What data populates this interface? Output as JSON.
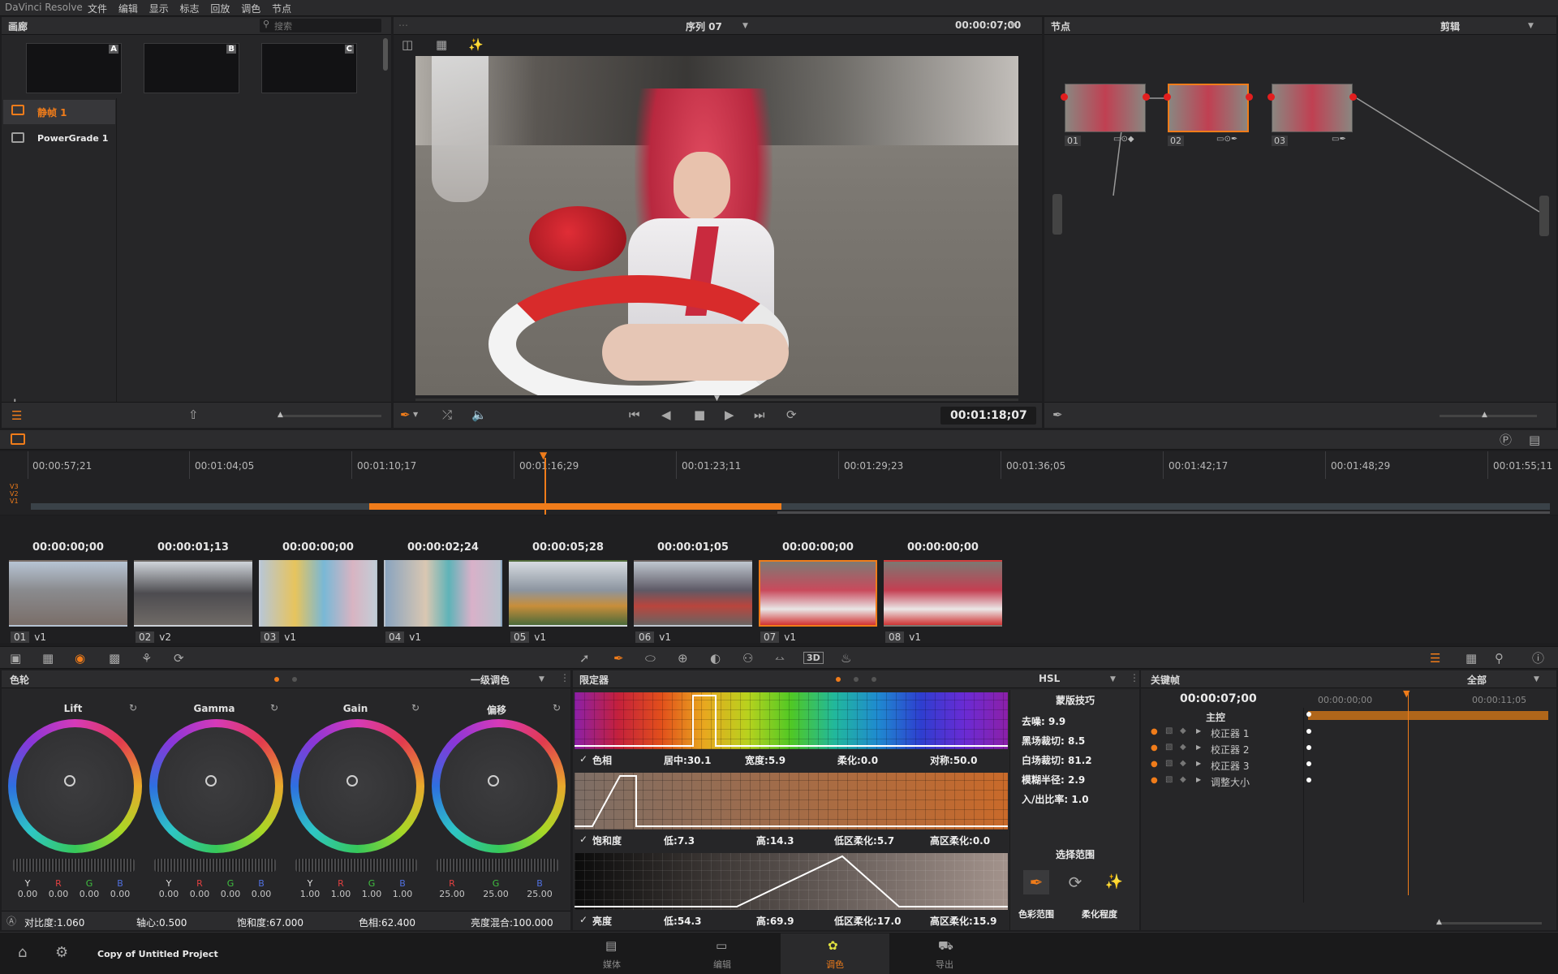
{
  "menubar": {
    "app": "DaVinci Resolve",
    "items": [
      "文件",
      "编辑",
      "显示",
      "标志",
      "回放",
      "调色",
      "节点"
    ]
  },
  "gallery": {
    "title": "画廊",
    "search_placeholder": "搜索",
    "stills": [
      "A",
      "B",
      "C"
    ],
    "albums": [
      {
        "label": "静帧 1",
        "selected": true
      },
      {
        "label": "PowerGrade 1",
        "selected": false
      }
    ]
  },
  "viewer": {
    "sequence": "序列 07",
    "timecode_top": "00:00:07;00",
    "timecode": "00:01:18;07"
  },
  "nodes": {
    "title": "节点",
    "mode": "剪辑",
    "items": [
      {
        "num": "01"
      },
      {
        "num": "02",
        "selected": true
      },
      {
        "num": "03"
      }
    ]
  },
  "timeline": {
    "ruler": [
      "00:00:57;21",
      "00:01:04;05",
      "00:01:10;17",
      "00:01:16;29",
      "00:01:23;11",
      "00:01:29;23",
      "00:01:36;05",
      "00:01:42;17",
      "00:01:48;29",
      "00:01:55;11"
    ],
    "tracks": [
      "V3",
      "V2",
      "V1"
    ]
  },
  "clips": [
    {
      "tc": "00:00:00;00",
      "num": "01",
      "track": "v1"
    },
    {
      "tc": "00:00:01;13",
      "num": "02",
      "track": "v2"
    },
    {
      "tc": "00:00:00;00",
      "num": "03",
      "track": "v1"
    },
    {
      "tc": "00:00:02;24",
      "num": "04",
      "track": "v1"
    },
    {
      "tc": "00:00:05;28",
      "num": "05",
      "track": "v1"
    },
    {
      "tc": "00:00:01;05",
      "num": "06",
      "track": "v1"
    },
    {
      "tc": "00:00:00;00",
      "num": "07",
      "track": "v1",
      "selected": true
    },
    {
      "tc": "00:00:00;00",
      "num": "08",
      "track": "v1"
    }
  ],
  "colorwheels": {
    "title": "色轮",
    "mode": "一级调色",
    "wheels": [
      {
        "name": "Lift",
        "labels": [
          "Y",
          "R",
          "G",
          "B"
        ],
        "values": [
          "0.00",
          "0.00",
          "0.00",
          "0.00"
        ]
      },
      {
        "name": "Gamma",
        "labels": [
          "Y",
          "R",
          "G",
          "B"
        ],
        "values": [
          "0.00",
          "0.00",
          "0.00",
          "0.00"
        ]
      },
      {
        "name": "Gain",
        "labels": [
          "Y",
          "R",
          "G",
          "B"
        ],
        "values": [
          "1.00",
          "1.00",
          "1.00",
          "1.00"
        ]
      },
      {
        "name": "偏移",
        "labels": [
          "R",
          "G",
          "B"
        ],
        "values": [
          "25.00",
          "25.00",
          "25.00"
        ]
      }
    ],
    "footer": {
      "contrast_label": "对比度:",
      "contrast": "1.060",
      "pivot_label": "轴心:",
      "pivot": "0.500",
      "sat_label": "饱和度:",
      "sat": "67.000",
      "hue_label": "色相:",
      "hue": "62.400",
      "lummix_label": "亮度混合:",
      "lummix": "100.000"
    }
  },
  "qualifier": {
    "title": "限定器",
    "mode": "HSL",
    "hue": {
      "label": "色相",
      "center_label": "居中:",
      "center": "30.1",
      "width_label": "宽度:",
      "width": "5.9",
      "soft_label": "柔化:",
      "soft": "0.0",
      "sym_label": "对称:",
      "sym": "50.0"
    },
    "sat": {
      "label": "饱和度",
      "low_label": "低:",
      "low": "7.3",
      "high_label": "高:",
      "high": "14.3",
      "lowsoft_label": "低区柔化:",
      "lowsoft": "5.7",
      "highsoft_label": "高区柔化:",
      "highsoft": "0.0"
    },
    "lum": {
      "label": "亮度",
      "low_label": "低:",
      "low": "54.3",
      "high_label": "高:",
      "high": "69.9",
      "lowsoft_label": "低区柔化:",
      "lowsoft": "17.0",
      "highsoft_label": "高区柔化:",
      "highsoft": "15.9"
    },
    "matte": {
      "title": "蒙版技巧",
      "rows": [
        {
          "label": "去噪:",
          "value": "9.9"
        },
        {
          "label": "黑场裁切:",
          "value": "8.5"
        },
        {
          "label": "白场裁切:",
          "value": "81.2"
        },
        {
          "label": "模糊半径:",
          "value": "2.9"
        },
        {
          "label": "入/出比率:",
          "value": "1.0"
        }
      ]
    },
    "select": {
      "title": "选择范围",
      "color_range": "色彩范围",
      "softness": "柔化程度"
    }
  },
  "keyframes": {
    "title": "关键帧",
    "mode": "全部",
    "timecode": "00:00:07;00",
    "ruler": [
      "00:00:00;00",
      "00:00:11;05"
    ],
    "tracks": [
      "主控",
      "校正器 1",
      "校正器 2",
      "校正器 3",
      "调整大小"
    ]
  },
  "footer": {
    "project": "Copy of Untitled Project",
    "tabs": [
      {
        "label": "媒体"
      },
      {
        "label": "编辑"
      },
      {
        "label": "调色",
        "active": true
      },
      {
        "label": "导出"
      }
    ]
  },
  "colors": {
    "accent": "#f07c1a",
    "bg": "#1d1d1f",
    "panel": "#262628"
  }
}
